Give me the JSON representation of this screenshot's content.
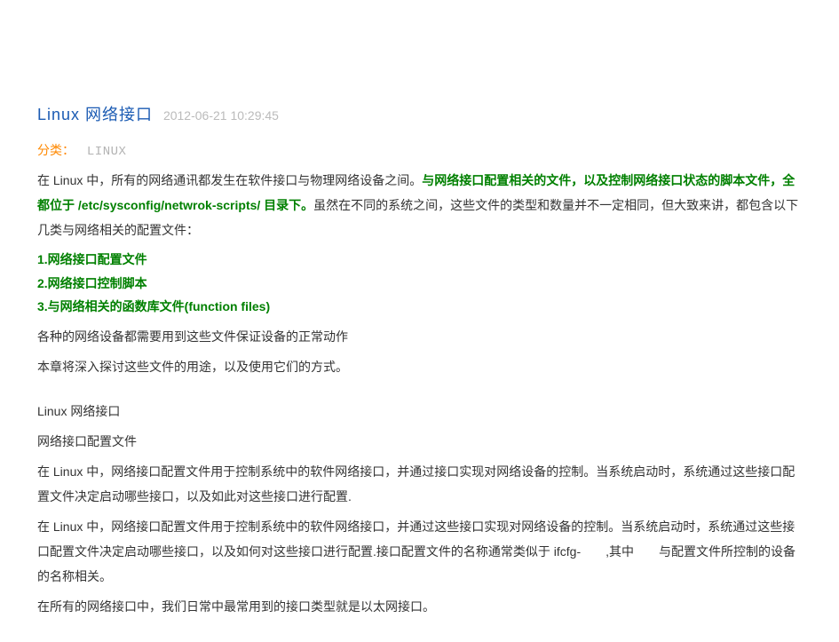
{
  "header": {
    "title": "Linux  网络接口",
    "timestamp": "2012-06-21 10:29:45"
  },
  "category": {
    "label": "分类：",
    "value": "LINUX"
  },
  "intro": {
    "prefix": "在 Linux 中，所有的网络通讯都发生在软件接口与物理网络设备之间。",
    "highlight": "与网络接口配置相关的文件，以及控制网络接口状态的脚本文件，全都位于 /etc/sysconfig/netwrok-scripts/ 目录下。",
    "suffix": "虽然在不同的系统之间，这些文件的类型和数量并不一定相同，但大致来讲，都包含以下几类与网络相关的配置文件："
  },
  "list": {
    "item1": "1.网络接口配置文件",
    "item2": "2.网络接口控制脚本",
    "item3": "3.与网络相关的函数库文件(function files)"
  },
  "para": {
    "p4": "各种的网络设备都需要用到这些文件保证设备的正常动作",
    "p5": "本章将深入探讨这些文件的用途，以及使用它们的方式。",
    "p6": "Linux 网络接口",
    "p7": "网络接口配置文件",
    "p8": "在 Linux 中，网络接口配置文件用于控制系统中的软件网络接口，并通过接口实现对网络设备的控制。当系统启动时，系统通过这些接口配置文件决定启动哪些接口，以及如此对这些接口进行配置.",
    "p9": "在 Linux 中，网络接口配置文件用于控制系统中的软件网络接口，并通过这些接口实现对网络设备的控制。当系统启动时，系统通过这些接口配置文件决定启动哪些接口，以及如何对这些接口进行配置.接口配置文件的名称通常类似于 ifcfg-  ,其中  与配置文件所控制的设备的名称相关。",
    "p10": "在所有的网络接口中，我们日常中最常用到的接口类型就是以太网接口。"
  }
}
